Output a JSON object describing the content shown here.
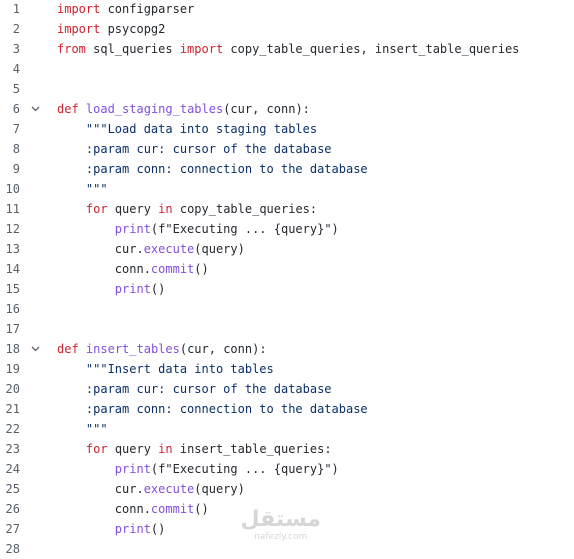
{
  "editor": {
    "lines": [
      {
        "n": "1",
        "code": [
          [
            "kw",
            "import"
          ],
          [
            "plain",
            " configparser"
          ]
        ]
      },
      {
        "n": "2",
        "code": [
          [
            "kw",
            "import"
          ],
          [
            "plain",
            " psycopg2"
          ]
        ]
      },
      {
        "n": "3",
        "code": [
          [
            "kw",
            "from"
          ],
          [
            "plain",
            " sql_queries "
          ],
          [
            "kw",
            "import"
          ],
          [
            "plain",
            " copy_table_queries, insert_table_queries"
          ]
        ]
      },
      {
        "n": "4",
        "code": []
      },
      {
        "n": "5",
        "code": []
      },
      {
        "n": "6",
        "fold": true,
        "code": [
          [
            "kw",
            "def"
          ],
          [
            "plain",
            " "
          ],
          [
            "fn",
            "load_staging_tables"
          ],
          [
            "plain",
            "(cur, conn):"
          ]
        ]
      },
      {
        "n": "7",
        "code": [
          [
            "plain",
            "    "
          ],
          [
            "cm",
            "\"\"\"Load data into staging tables"
          ]
        ]
      },
      {
        "n": "8",
        "code": [
          [
            "cm",
            "    :param cur: cursor of the database"
          ]
        ]
      },
      {
        "n": "9",
        "code": [
          [
            "cm",
            "    :param conn: connection to the database"
          ]
        ]
      },
      {
        "n": "10",
        "code": [
          [
            "cm",
            "    \"\"\""
          ]
        ]
      },
      {
        "n": "11",
        "code": [
          [
            "plain",
            "    "
          ],
          [
            "kw",
            "for"
          ],
          [
            "plain",
            " query "
          ],
          [
            "kw",
            "in"
          ],
          [
            "plain",
            " copy_table_queries:"
          ]
        ]
      },
      {
        "n": "12",
        "code": [
          [
            "plain",
            "        "
          ],
          [
            "fn",
            "print"
          ],
          [
            "plain",
            "(f\"Executing ... {query}\")"
          ]
        ]
      },
      {
        "n": "13",
        "code": [
          [
            "plain",
            "        cur."
          ],
          [
            "fn",
            "execute"
          ],
          [
            "plain",
            "(query)"
          ]
        ]
      },
      {
        "n": "14",
        "code": [
          [
            "plain",
            "        conn."
          ],
          [
            "fn",
            "commit"
          ],
          [
            "plain",
            "()"
          ]
        ]
      },
      {
        "n": "15",
        "code": [
          [
            "plain",
            "        "
          ],
          [
            "fn",
            "print"
          ],
          [
            "plain",
            "()"
          ]
        ]
      },
      {
        "n": "16",
        "code": []
      },
      {
        "n": "17",
        "code": []
      },
      {
        "n": "18",
        "fold": true,
        "code": [
          [
            "kw",
            "def"
          ],
          [
            "plain",
            " "
          ],
          [
            "fn",
            "insert_tables"
          ],
          [
            "plain",
            "(cur, conn):"
          ]
        ]
      },
      {
        "n": "19",
        "code": [
          [
            "plain",
            "    "
          ],
          [
            "cm",
            "\"\"\"Insert data into tables"
          ]
        ]
      },
      {
        "n": "20",
        "code": [
          [
            "cm",
            "    :param cur: cursor of the database"
          ]
        ]
      },
      {
        "n": "21",
        "code": [
          [
            "cm",
            "    :param conn: connection to the database"
          ]
        ]
      },
      {
        "n": "22",
        "code": [
          [
            "cm",
            "    \"\"\""
          ]
        ]
      },
      {
        "n": "23",
        "code": [
          [
            "plain",
            "    "
          ],
          [
            "kw",
            "for"
          ],
          [
            "plain",
            " query "
          ],
          [
            "kw",
            "in"
          ],
          [
            "plain",
            " insert_table_queries:"
          ]
        ]
      },
      {
        "n": "24",
        "code": [
          [
            "plain",
            "        "
          ],
          [
            "fn",
            "print"
          ],
          [
            "plain",
            "(f\"Executing ... {query}\")"
          ]
        ]
      },
      {
        "n": "25",
        "code": [
          [
            "plain",
            "        cur."
          ],
          [
            "fn",
            "execute"
          ],
          [
            "plain",
            "(query)"
          ]
        ]
      },
      {
        "n": "26",
        "code": [
          [
            "plain",
            "        conn."
          ],
          [
            "fn",
            "commit"
          ],
          [
            "plain",
            "()"
          ]
        ]
      },
      {
        "n": "27",
        "code": [
          [
            "plain",
            "        "
          ],
          [
            "fn",
            "print"
          ],
          [
            "plain",
            "()"
          ]
        ]
      },
      {
        "n": "28",
        "code": []
      }
    ],
    "colors": {
      "keyword": "#cf222e",
      "function": "#8250df",
      "docstring": "#0a3069",
      "text": "#24292f",
      "line_number": "#57606a",
      "background": "#ffffff"
    },
    "fold_icon": "chevron-down-icon"
  },
  "watermark": {
    "logo_text": "مستقل",
    "url": "nafezly.com"
  }
}
